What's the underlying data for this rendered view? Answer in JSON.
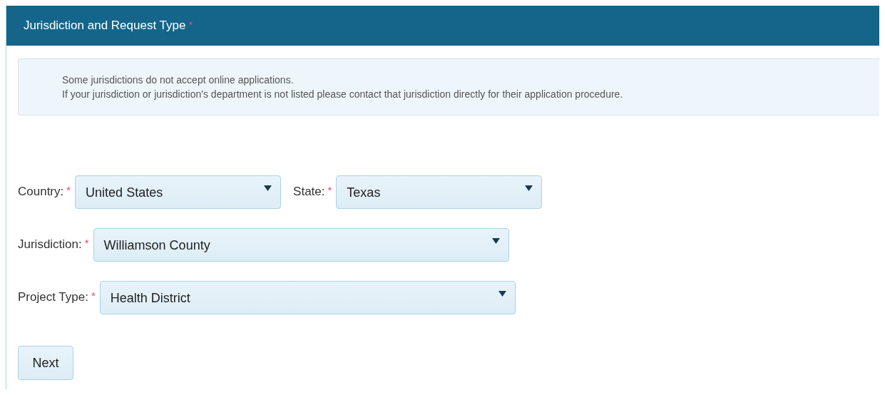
{
  "panel": {
    "title": "Jurisdiction and Request Type",
    "required_mark": "*"
  },
  "notice": {
    "lines": [
      "Some jurisdictions do not accept online applications.",
      "If your jurisdiction or jurisdiction's department is not listed please contact that jurisdiction directly for their application procedure."
    ]
  },
  "rows": [
    {
      "fields": [
        {
          "label": "Country:",
          "required_mark": "*",
          "value": "United States"
        },
        {
          "label": "State:",
          "required_mark": "*",
          "value": "Texas"
        }
      ]
    },
    {
      "fields": [
        {
          "label": "Jurisdiction:",
          "required_mark": "*",
          "value": "Williamson County"
        }
      ]
    },
    {
      "fields": [
        {
          "label": "Project Type:",
          "required_mark": "*",
          "value": "Health District"
        }
      ]
    }
  ],
  "buttons": [
    "Next"
  ]
}
